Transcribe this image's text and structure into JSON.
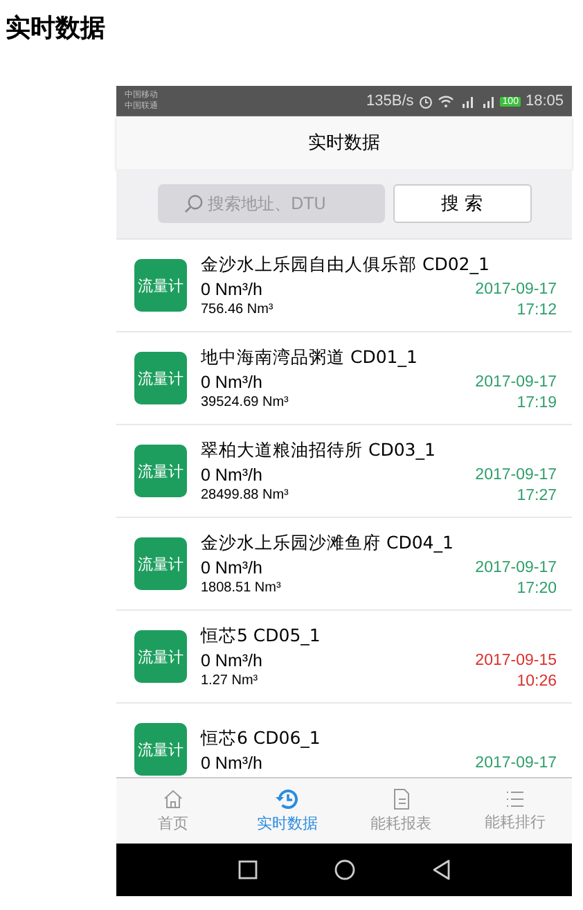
{
  "page_title": "实时数据",
  "status_bar": {
    "carriers": [
      "中国移动",
      "中国联通"
    ],
    "speed": "135B/s",
    "battery": "100",
    "time": "18:05"
  },
  "header": {
    "title": "实时数据"
  },
  "search": {
    "placeholder": "搜索地址、DTU",
    "button": "搜 索"
  },
  "rows": [
    {
      "badge": "流量计",
      "name": "金沙水上乐园自由人俱乐部 CD02_1",
      "rate": "0 Nm³/h",
      "total": "756.46 Nm³",
      "date": "2017-09-17",
      "time": "17:12",
      "color": "#2e9e6a"
    },
    {
      "badge": "流量计",
      "name": "地中海南湾品粥道 CD01_1",
      "rate": "0 Nm³/h",
      "total": "39524.69 Nm³",
      "date": "2017-09-17",
      "time": "17:19",
      "color": "#2e9e6a"
    },
    {
      "badge": "流量计",
      "name": "翠柏大道粮油招待所 CD03_1",
      "rate": "0 Nm³/h",
      "total": "28499.88 Nm³",
      "date": "2017-09-17",
      "time": "17:27",
      "color": "#2e9e6a"
    },
    {
      "badge": "流量计",
      "name": "金沙水上乐园沙滩鱼府 CD04_1",
      "rate": "0 Nm³/h",
      "total": "1808.51 Nm³",
      "date": "2017-09-17",
      "time": "17:20",
      "color": "#2e9e6a"
    },
    {
      "badge": "流量计",
      "name": "恒芯5 CD05_1",
      "rate": "0 Nm³/h",
      "total": "1.27 Nm³",
      "date": "2017-09-15",
      "time": "10:26",
      "color": "#d9302c"
    },
    {
      "badge": "流量计",
      "name": "恒芯6 CD06_1",
      "rate": "0 Nm³/h",
      "date": "2017-09-17",
      "color": "#2e9e6a"
    }
  ],
  "tabs": [
    {
      "label": "首页",
      "kind": "home",
      "selected": false
    },
    {
      "label": "实时数据",
      "kind": "history",
      "selected": true
    },
    {
      "label": "能耗报表",
      "kind": "doc",
      "selected": false
    },
    {
      "label": "能耗排行",
      "kind": "list",
      "selected": false
    }
  ]
}
